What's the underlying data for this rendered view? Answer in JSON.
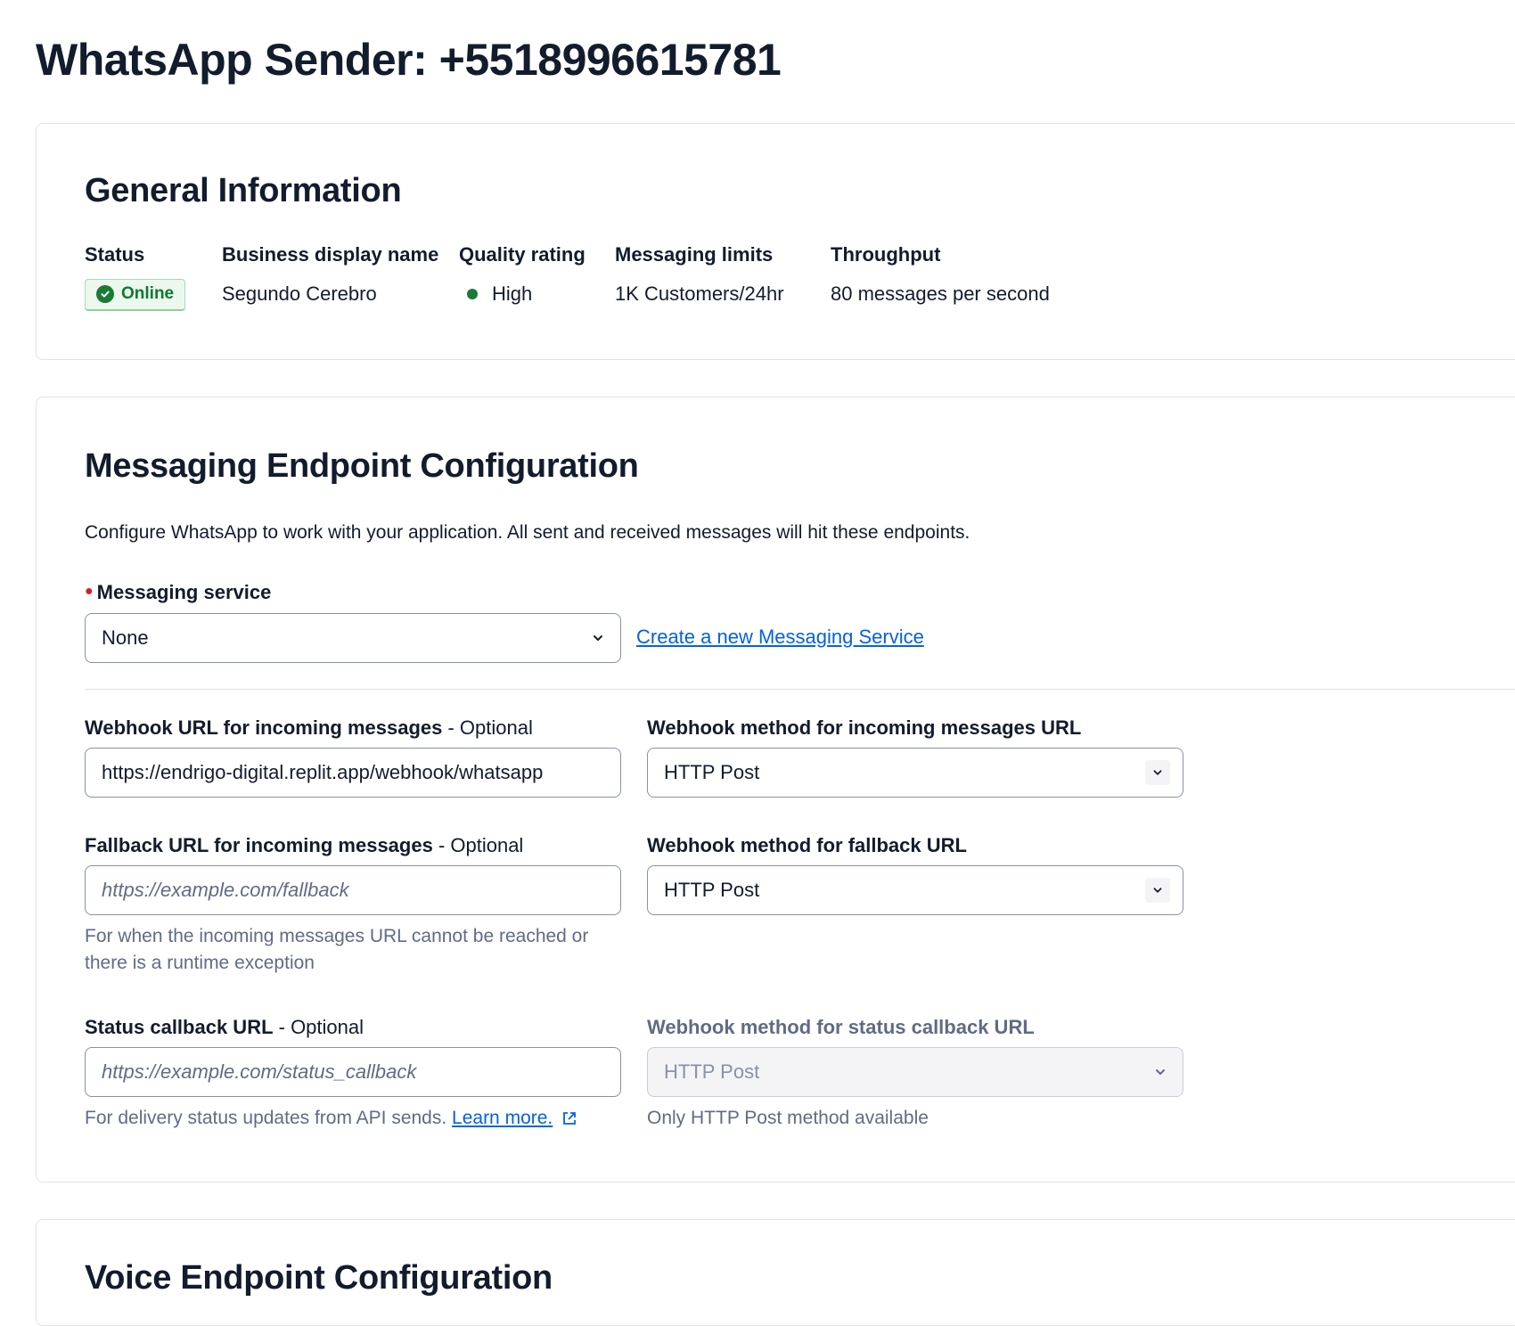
{
  "page": {
    "title": "WhatsApp Sender: +5518996615781"
  },
  "general": {
    "heading": "General Information",
    "status": {
      "label": "Status",
      "value": "Online"
    },
    "business_name": {
      "label": "Business display name",
      "value": "Segundo Cerebro"
    },
    "quality": {
      "label": "Quality rating",
      "value": "High"
    },
    "limits": {
      "label": "Messaging limits",
      "value": "1K Customers/24hr"
    },
    "throughput": {
      "label": "Throughput",
      "value": "80 messages per second"
    }
  },
  "messaging": {
    "heading": "Messaging Endpoint Configuration",
    "description": "Configure WhatsApp to work with your application. All sent and received messages will hit these endpoints.",
    "service": {
      "label": "Messaging service",
      "selected": "None",
      "create_link": "Create a new Messaging Service"
    },
    "webhook_url": {
      "label": "Webhook URL for incoming messages",
      "optional": " - Optional",
      "value": "https://endrigo-digital.replit.app/webhook/whatsapp"
    },
    "webhook_method": {
      "label": "Webhook method for incoming messages URL",
      "selected": "HTTP Post"
    },
    "fallback_url": {
      "label": "Fallback URL for incoming messages",
      "optional": " - Optional",
      "placeholder": "https://example.com/fallback",
      "help_line1": "For when the incoming messages URL cannot be reached or",
      "help_line2": "there is a runtime exception"
    },
    "fallback_method": {
      "label": "Webhook method for fallback URL",
      "selected": "HTTP Post"
    },
    "status_url": {
      "label": "Status callback URL",
      "optional": " - Optional",
      "placeholder": "https://example.com/status_callback",
      "help": "For delivery status updates from API sends. ",
      "learn_more": "Learn more."
    },
    "status_method": {
      "label": "Webhook method for status callback URL",
      "selected": "HTTP Post",
      "help": "Only HTTP Post method available"
    }
  },
  "voice": {
    "heading": "Voice Endpoint Configuration"
  },
  "colors": {
    "accent": "#0263e0",
    "success": "#1b7a34",
    "required": "#d61f1f"
  }
}
